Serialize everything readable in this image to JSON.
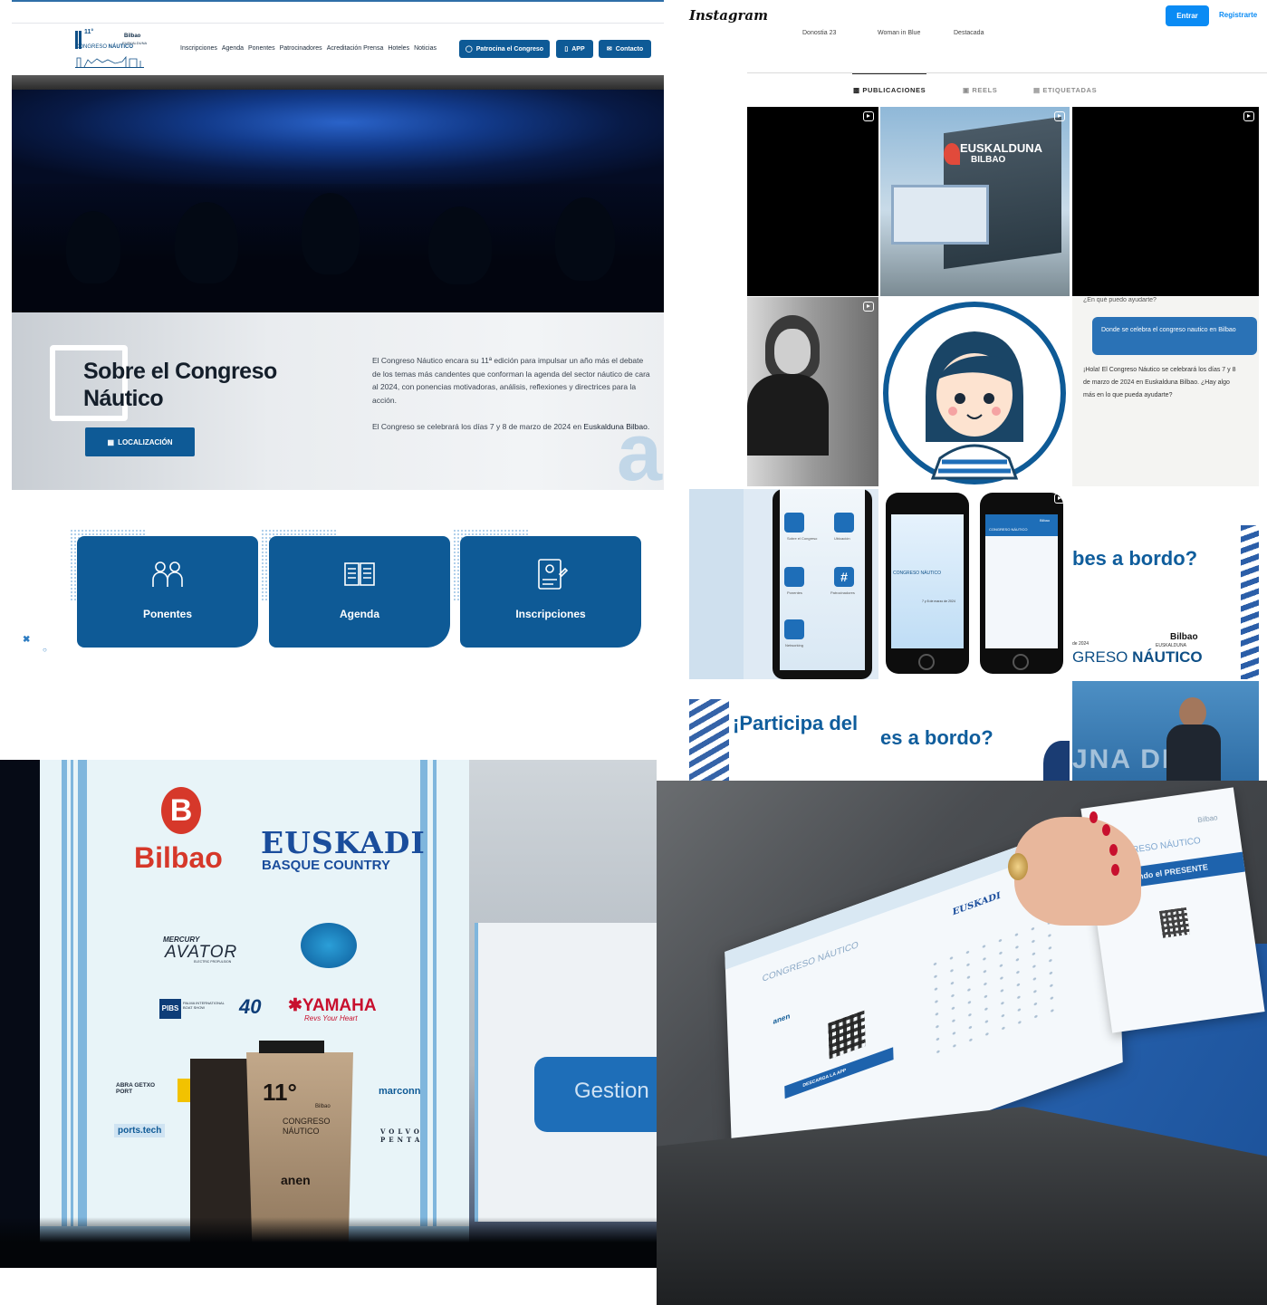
{
  "site": {
    "logo": {
      "edition": "11°",
      "city": "Bilbao",
      "venue": "EUSKALDUNA",
      "name_part1": "CONGRESO ",
      "name_part2": "NÁUTICO"
    },
    "nav": [
      "Inscripciones",
      "Agenda",
      "Ponentes",
      "Patrocinadores",
      "Acreditación Prensa",
      "Hoteles",
      "Noticias"
    ],
    "buttons": {
      "sponsor": "Patrocina el Congreso",
      "app": "APP",
      "contact": "Contacto"
    },
    "about": {
      "title_line1": "Sobre el Congreso",
      "title_line2": "Náutico",
      "location_button": "LOCALIZACIÓN",
      "paragraph1": "El Congreso Náutico encara su 11ª edición para impulsar un año más  el debate de los temas más candentes que conforman la agenda del sector náutico de cara al 2024, con ponencias motivadoras, análisis,  reflexiones y directrices para la acción.",
      "paragraph2_prefix": "El Congreso se celebrará los días 7 y 8 de marzo de 2024 en ",
      "paragraph2_place": "Euskalduna Bilbao.",
      "watermark": "anen"
    },
    "cards": [
      "Ponentes",
      "Agenda",
      "Inscripciones"
    ]
  },
  "instagram": {
    "logo": "Instagram",
    "login": "Entrar",
    "register": "Registrarte",
    "highlights": [
      "Donostia 23",
      "Woman in Blue",
      "Destacada"
    ],
    "tabs": [
      "PUBLICACIONES",
      "REELS",
      "ETIQUETADAS"
    ],
    "post_building_sign": "EUSKALDUNA",
    "post_building_sign2": "BILBAO",
    "chat": {
      "prompt": "¿En qué puedo ayudarte?",
      "question": "Donde se celebra el congreso nautico en Bilbao",
      "answer": "¡Hola! El Congreso Náutico se celebrará los días 7 y 8 de marzo de 2024 en Euskalduna Bilbao. ¿Hay algo más en lo que pueda ayudarte?"
    },
    "app_screens": {
      "menu_items": [
        "Sobre el Congreso",
        "Ubicación",
        "Ponentes",
        "Patrocinadores",
        "Networking"
      ],
      "splash_name": "CONGRESO NÁUTICO",
      "splash_date": "7 y 8 de marzo de 2024",
      "header_name": "CONGRESO NÁUTICO",
      "header_city": "Bilbao"
    },
    "promo_text_1": "bes a bordo?",
    "promo_city": "Bilbao",
    "promo_venue": "EUSKALDUNA",
    "promo_year": "de 2024",
    "promo_name_1": "GRESO ",
    "promo_name_2": "NÁUTICO",
    "promo_text_2": "¡Participa del",
    "promo_text_3": "es a bordo?",
    "promo_text_4": "JNA DE"
  },
  "stage_photo": {
    "bilbao_letter": "B",
    "bilbao": "Bilbao",
    "euskadi": "EUSKADI",
    "basque": "BASQUE COUNTRY",
    "sponsors": [
      "MERCURY",
      "AVATOR",
      "ELECTRIC PROPULSION",
      "PIBS",
      "PALMA INTERNATIONAL BOAT SHOW",
      "YAMAHA",
      "Revs Your Heart",
      "ABRA GETXO PORT",
      "marconn",
      "ports.tech",
      "VOLVO PENTA"
    ],
    "podium_edition": "11°",
    "podium_city": "Bilbao",
    "podium_name": "CONGRESO NÁUTICO",
    "podium_org": "anen",
    "screen_word": "Gestion"
  },
  "brochure_photo": {
    "badge_city": "Bilbao",
    "badge_title": "CONGRESO NÁUTICO",
    "badge_band": "Gestionando el PRESENTE",
    "brochure_euskadi": "EUSKADI",
    "brochure_title": "CONGRESO NÁUTICO",
    "brochure_cta": "DESCARGA LA APP",
    "brochure_org": "anen"
  }
}
